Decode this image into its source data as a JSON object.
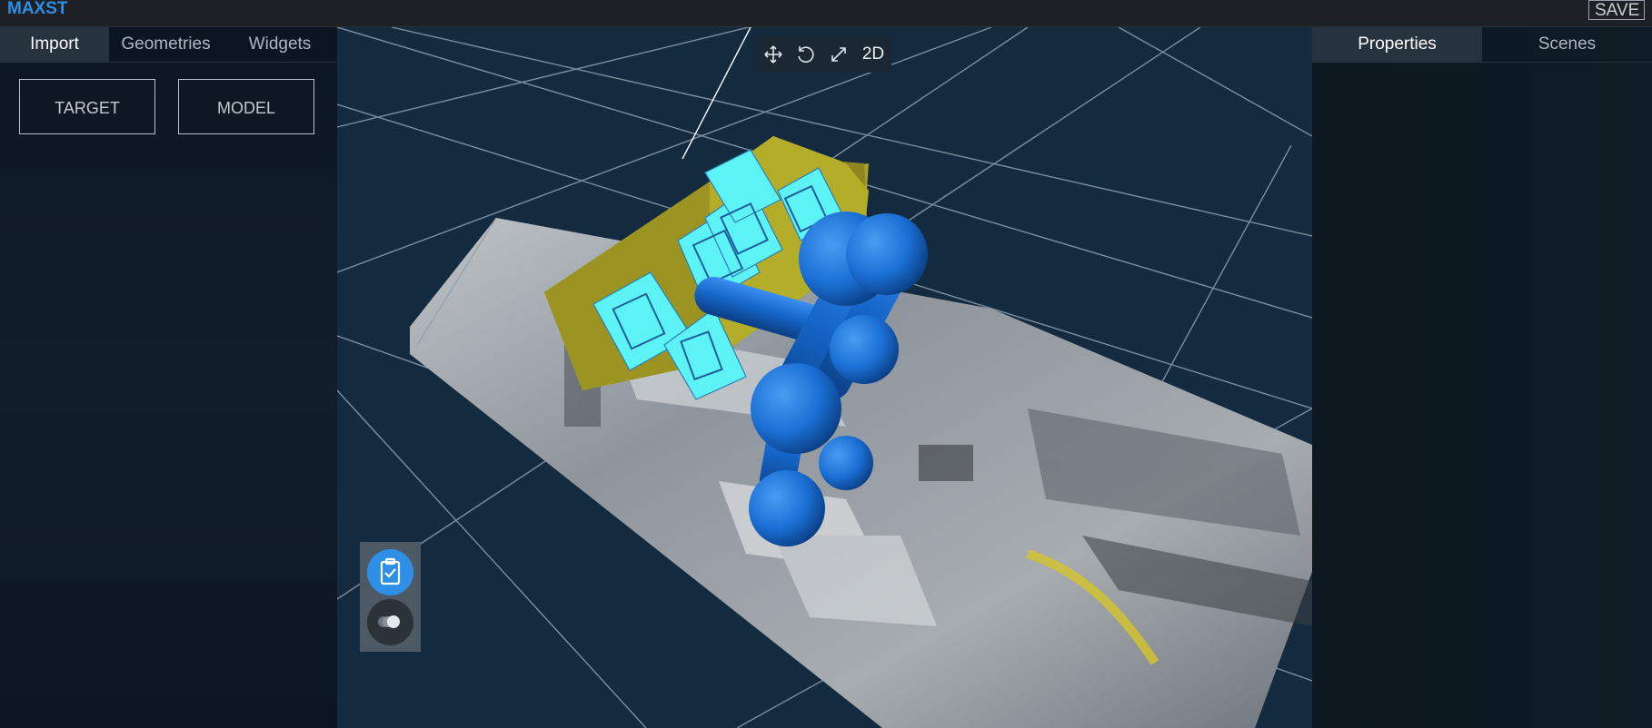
{
  "app": {
    "brand": "MAXST",
    "save_label": "SAVE"
  },
  "left_tabs": [
    {
      "label": "Import",
      "active": true
    },
    {
      "label": "Geometries",
      "active": false
    },
    {
      "label": "Widgets",
      "active": false
    }
  ],
  "import_buttons": {
    "target_label": "TARGET",
    "model_label": "MODEL"
  },
  "toolbar": {
    "icons": [
      "move-icon",
      "rotate-icon",
      "scale-icon"
    ],
    "mode_label": "2D"
  },
  "right_tabs": [
    {
      "label": "Properties",
      "active": true
    },
    {
      "label": "Scenes",
      "active": false
    }
  ],
  "float_panel": {
    "icons": [
      "clipboard-check-icon",
      "toggle-icon"
    ]
  },
  "colors": {
    "brand": "#2f8fe6",
    "viewport_bg": "#142a3f",
    "grid_lines": "#8fa0ae",
    "target_box": "#b4ad2a",
    "widget_cards": "#5cf2f6",
    "model_blue": "#1a6fd4"
  }
}
